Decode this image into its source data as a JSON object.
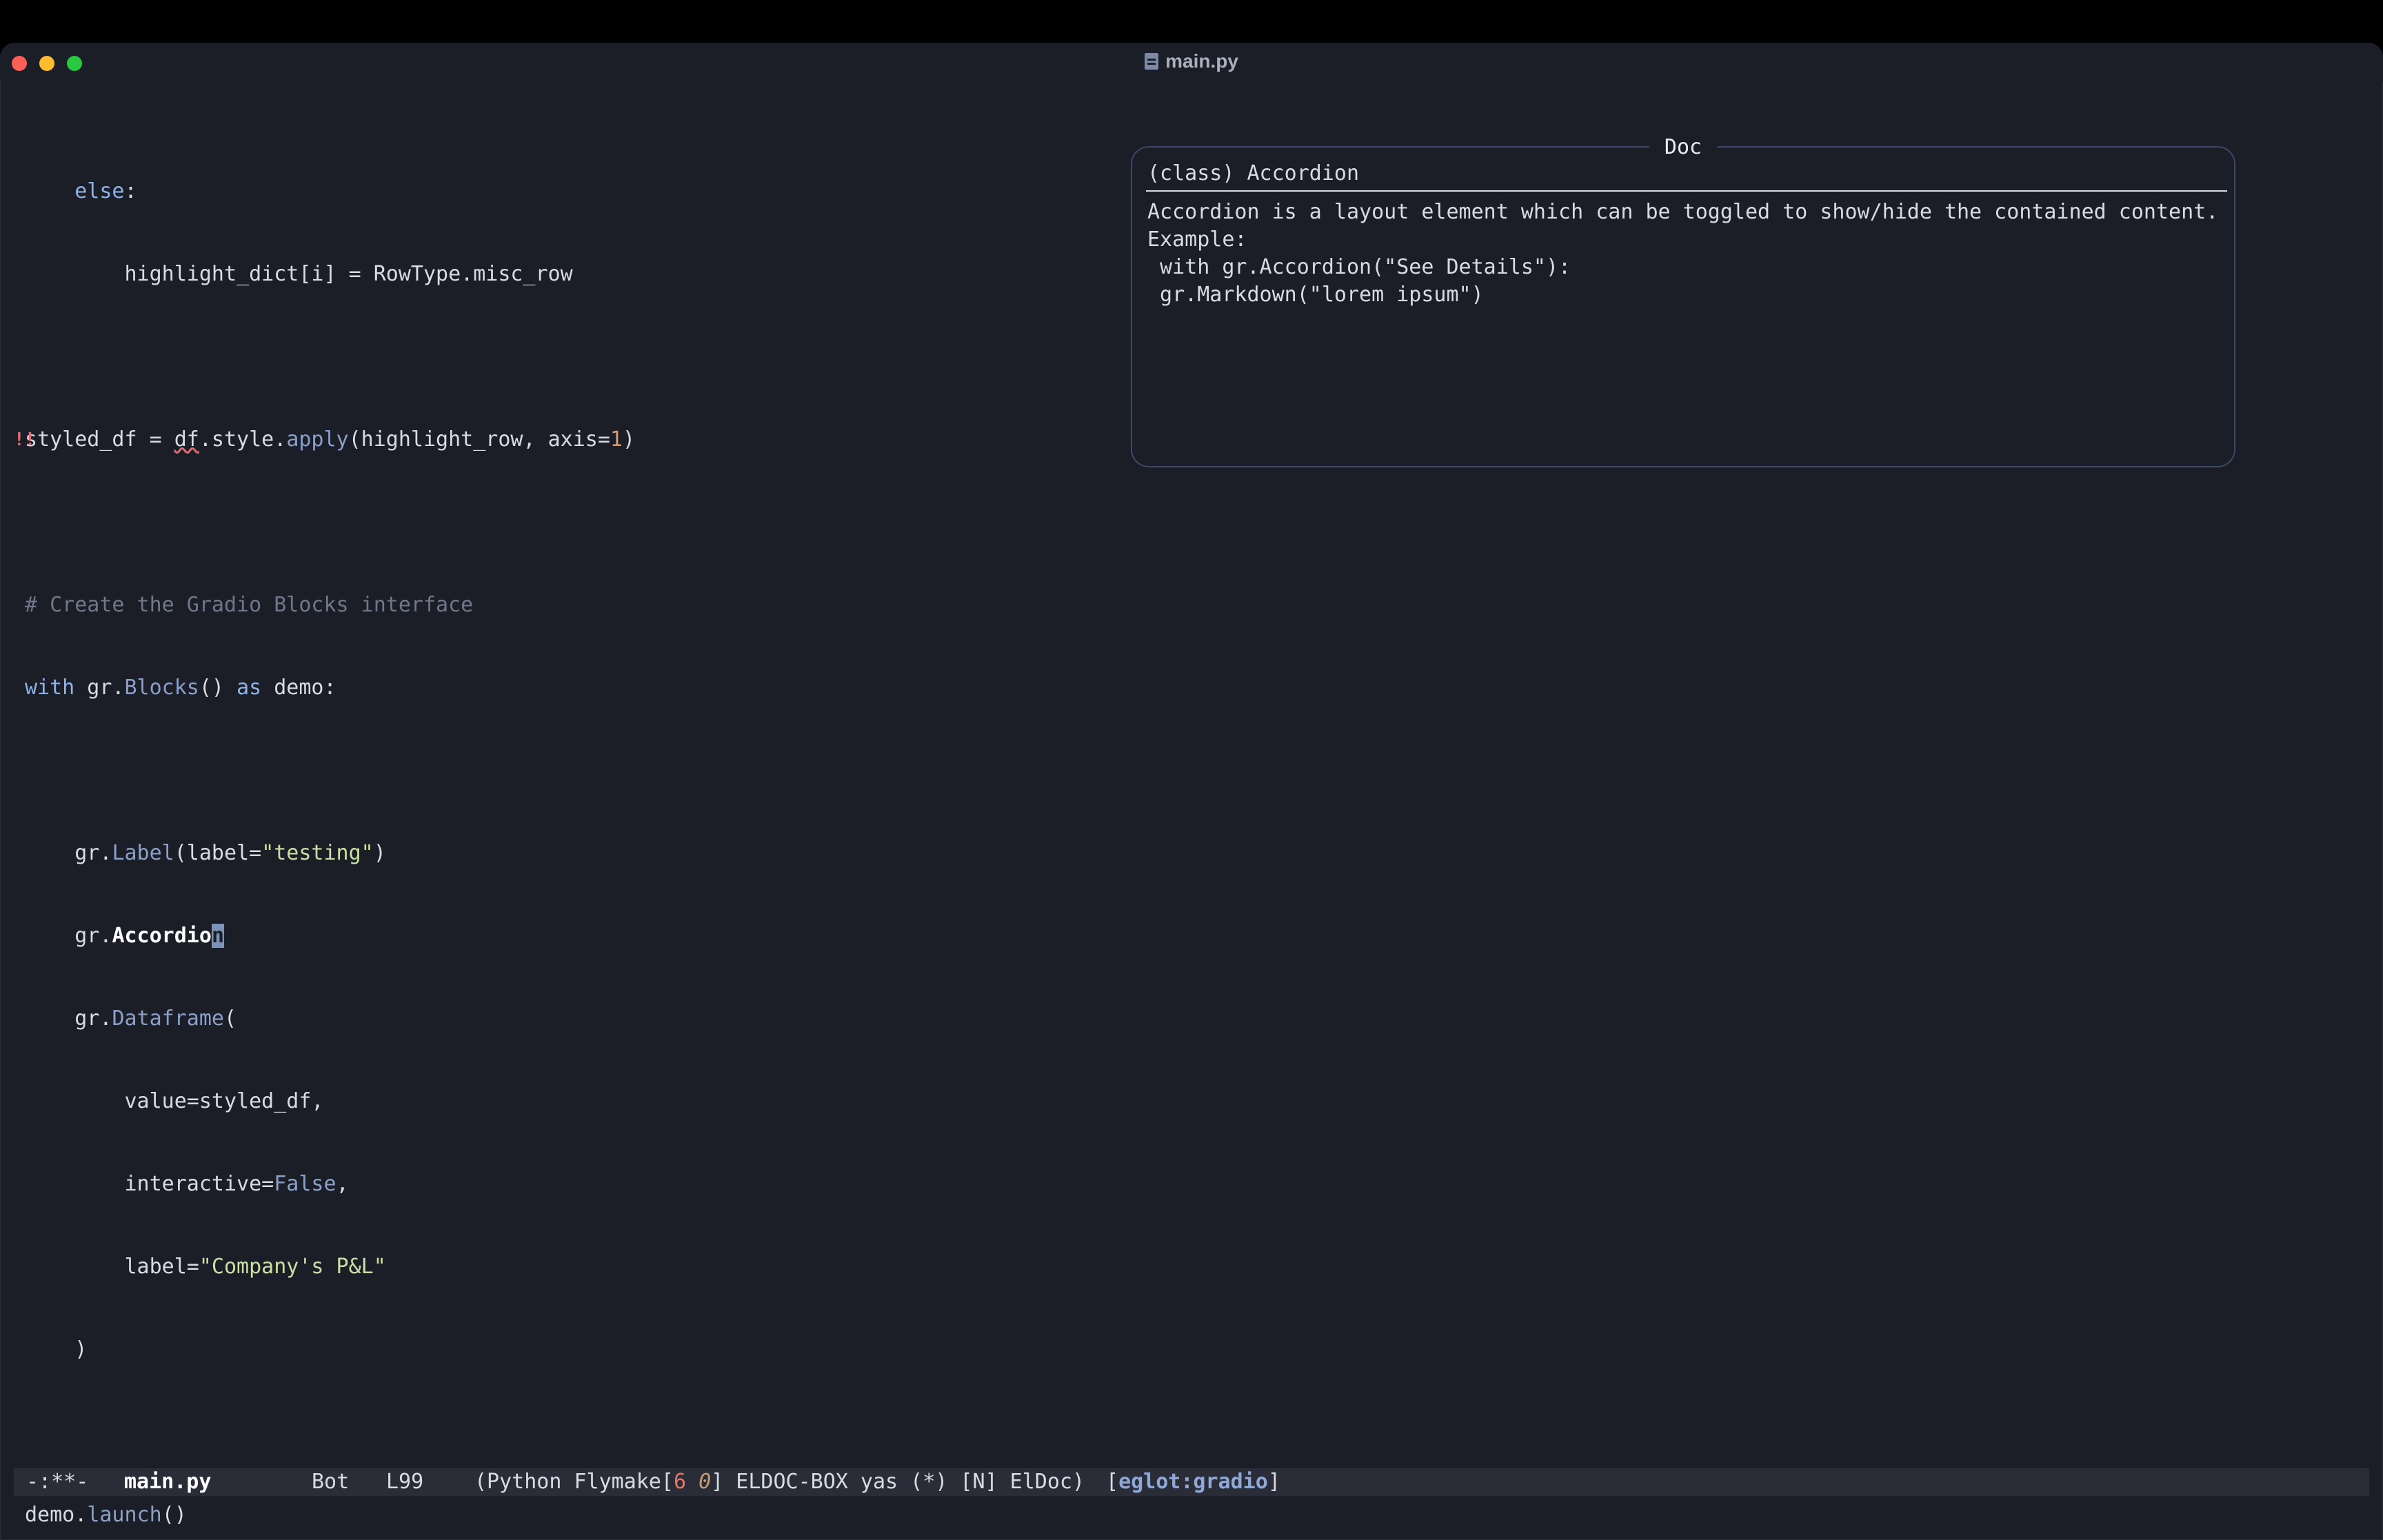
{
  "window": {
    "title": "main.py"
  },
  "code": {
    "lines": [
      {
        "id": "l1"
      },
      {
        "id": "l2"
      }
    ],
    "else_kw": "else",
    "else_colon": ":",
    "l2_text": "highlight_dict[i] = RowType.misc_row",
    "fringe": "!!",
    "l3_a": "styled_df = ",
    "l3_df": "df",
    "l3_b": ".style.",
    "l3_apply": "apply",
    "l3_c": "(highlight_row, axis=",
    "l3_num": "1",
    "l3_d": ")",
    "comment": "# Create the Gradio Blocks interface",
    "l5_with": "with",
    "l5_a": " gr.",
    "l5_blocks": "Blocks",
    "l5_b": "() ",
    "l5_as": "as",
    "l5_c": " demo:",
    "l6_a": "gr.",
    "l6_label": "Label",
    "l6_b": "(label=",
    "l6_str": "\"testing\"",
    "l6_c": ")",
    "l7_a": "gr.",
    "l7_bold": "Accordio",
    "l7_cursor": "n",
    "l8_a": "gr.",
    "l8_df": "Dataframe",
    "l8_b": "(",
    "l9": "value=styled_df,",
    "l10_a": "interactive=",
    "l10_false": "False",
    "l10_b": ",",
    "l11_a": "label=",
    "l11_str": "\"Company's P&L\"",
    "l12": ")",
    "l13_a": "demo.",
    "l13_launch": "launch",
    "l13_b": "()"
  },
  "doc": {
    "title": "Doc",
    "signature": "(class) Accordion",
    "body_lines": [
      "Accordion is a layout element which can be toggled to show/hide the contained content.",
      "Example:",
      " with gr.Accordion(\"See Details\"):",
      " gr.Markdown(\"lorem ipsum\")"
    ]
  },
  "modeline": {
    "state": "-:**-",
    "buffer": "main.py",
    "position": "Bot",
    "line": "L99",
    "modes_a": "(Python Flymake[",
    "errors": "6",
    "warnings": "0",
    "modes_b": "] ELDOC-BOX yas (*) [N] ElDoc)",
    "eglot_open": "[",
    "eglot_label": "eglot:gradio",
    "eglot_close": "]"
  }
}
